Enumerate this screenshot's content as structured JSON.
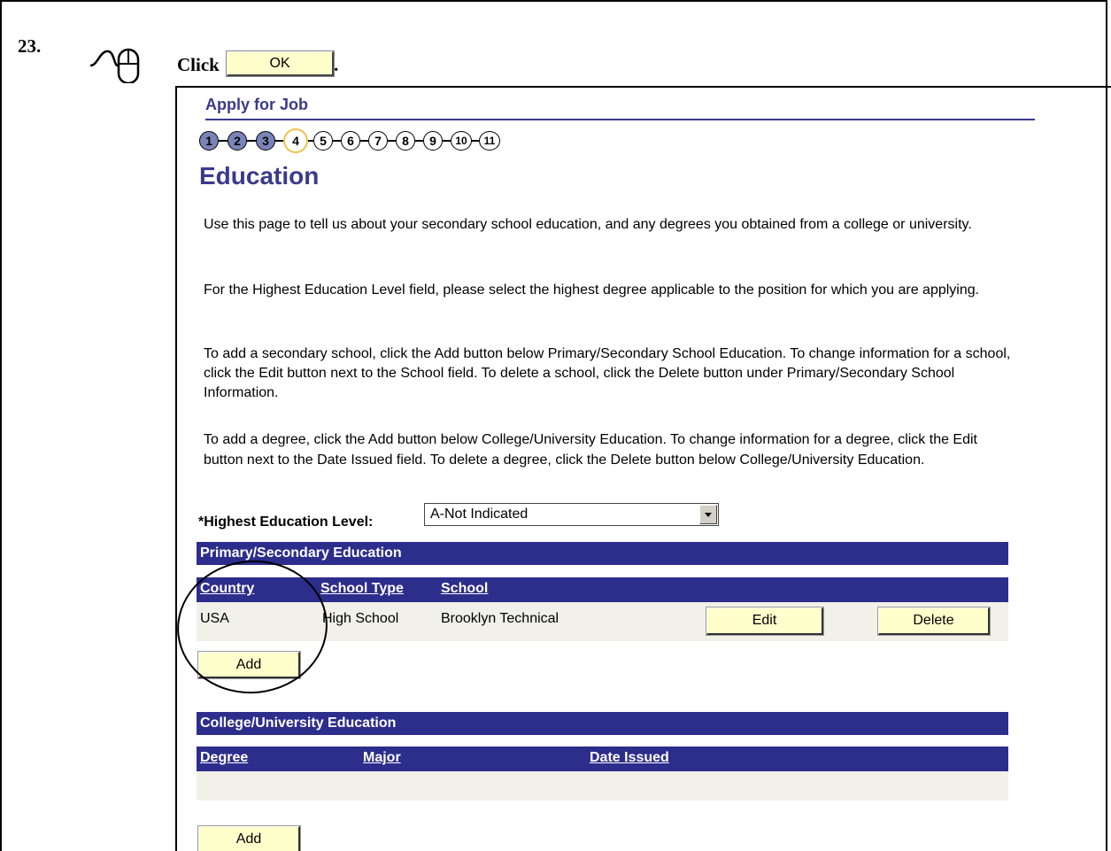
{
  "doc": {
    "step_number": "23.",
    "instruction_click": "Click",
    "instruction_button": "OK",
    "instruction_end": "."
  },
  "app": {
    "title": "Apply for Job",
    "steps": [
      "1",
      "2",
      "3",
      "4",
      "5",
      "6",
      "7",
      "8",
      "9",
      "10",
      "11"
    ],
    "completed_steps": 3,
    "current_step": 4,
    "page_title": "Education",
    "paragraphs": [
      "Use this page to tell us about your secondary school education, and any degrees you obtained from a college or university.",
      "For the Highest Education Level field, please select the highest degree applicable to the position for which you are applying.",
      "To add a secondary school, click the Add button below Primary/Secondary School Education. To change information for a school, click the Edit button next to the School field. To delete a school, click the Delete button under Primary/Secondary School Information.",
      "To add a degree, click the Add button below College/University Education. To change information for a degree, click the Edit button next to the Date Issued field. To delete a degree, click the Delete button below College/University Education."
    ],
    "highest_education": {
      "label": "*Highest Education Level:",
      "value": "A-Not Indicated"
    },
    "primary": {
      "header": "Primary/Secondary Education",
      "columns": [
        "Country",
        "School Type",
        "School"
      ],
      "rows": [
        {
          "country": "USA",
          "school_type": "High School",
          "school": "Brooklyn Technical"
        }
      ],
      "edit_label": "Edit",
      "delete_label": "Delete",
      "add_label": "Add"
    },
    "college": {
      "header": "College/University Education",
      "columns": [
        "Degree",
        "Major",
        "Date Issued"
      ],
      "add_label": "Add"
    }
  },
  "colors": {
    "header_bg": "#2d2d8c",
    "title": "#3a3a8c",
    "button_bg": "#ffffcc",
    "row_bg": "#f1f1ea"
  }
}
